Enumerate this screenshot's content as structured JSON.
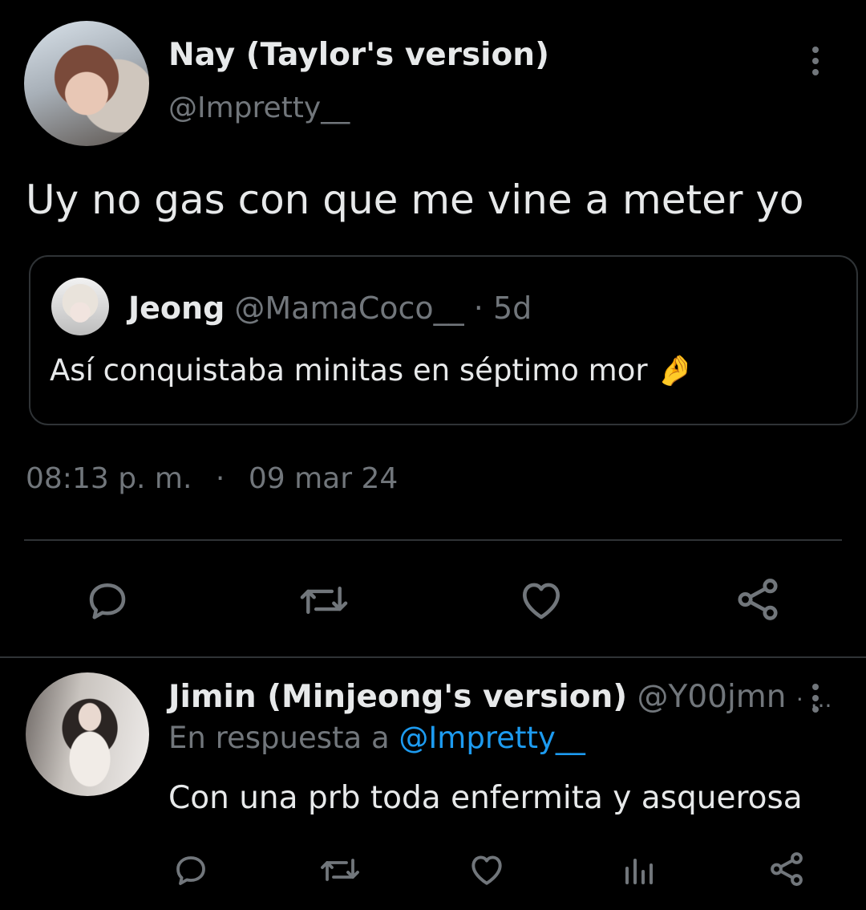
{
  "main_tweet": {
    "author_name": "Nay (Taylor's version)",
    "author_handle": "@Impretty__",
    "text": "Uy no gas con que me vine a meter yo",
    "time": "08:13 p. m.",
    "separator": "·",
    "date": "09 mar 24"
  },
  "quoted_tweet": {
    "author_name": "Jeong",
    "author_handle": "@MamaCoco__",
    "age": "· 5d",
    "text": "Así conquistaba minitas en séptimo mor",
    "emoji": "🤌"
  },
  "reply": {
    "author_name": "Jimin (Minjeong's version)",
    "author_handle": "@Y00jmn",
    "handle_suffix": "· ...",
    "reply_prefix": "En respuesta a",
    "reply_to": "@Impretty__",
    "text": "Con una prb toda enfermita y asquerosa"
  },
  "icons": {
    "reply": "comment-icon",
    "retweet": "retweet-icon",
    "like": "heart-icon",
    "share": "share-icon",
    "views": "views-icon",
    "more": "more-vertical-icon"
  },
  "colors": {
    "background": "#000000",
    "text": "#e7e9ea",
    "muted": "#71767b",
    "link": "#1d9bf0",
    "border": "#2f3336"
  }
}
